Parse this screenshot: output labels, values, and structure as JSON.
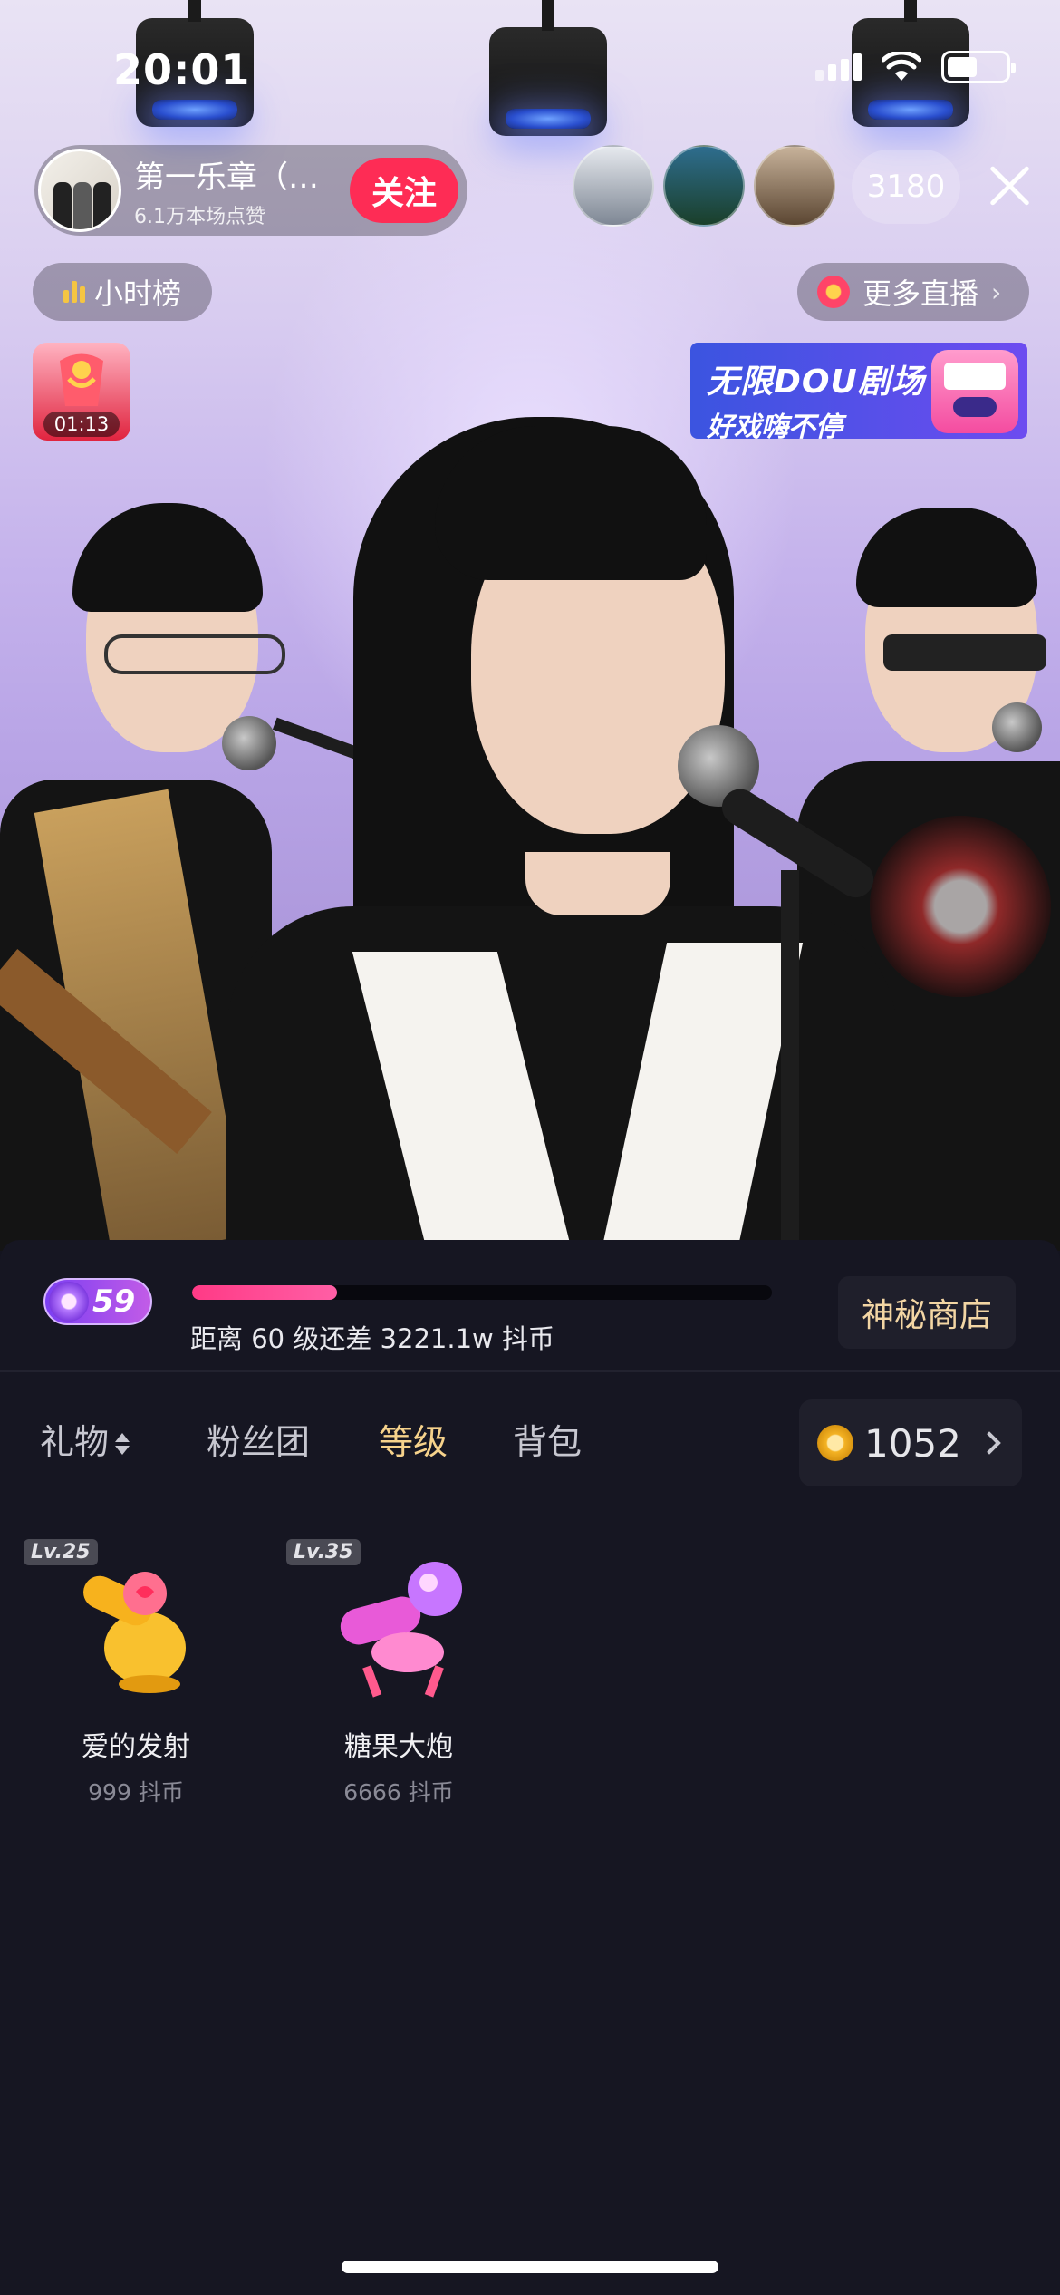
{
  "status_bar": {
    "time": "20:01"
  },
  "host": {
    "name": "第一乐章（…",
    "likes": "6.1万本场点赞",
    "follow_label": "关注"
  },
  "audience": {
    "count": "3180"
  },
  "rank_label": "小时榜",
  "more_live_label": "更多直播",
  "gift_timer": "01:13",
  "banner": {
    "line1": "无限DOU剧场",
    "line2": "好戏嗨不停"
  },
  "level": {
    "current": "59",
    "progress": 0.25,
    "text": "距离 60 级还差 3221.1w 抖币",
    "shop_label": "神秘商店"
  },
  "tabs": [
    {
      "label": "礼物",
      "active": false
    },
    {
      "label": "粉丝团",
      "active": false
    },
    {
      "label": "等级",
      "active": true
    },
    {
      "label": "背包",
      "active": false
    }
  ],
  "balance": "1052",
  "gifts": [
    {
      "level": "Lv.25",
      "name": "爱的发射",
      "price": "999 抖币",
      "icon": "love-launcher-icon"
    },
    {
      "level": "Lv.35",
      "name": "糖果大炮",
      "price": "6666 抖币",
      "icon": "candy-cannon-icon"
    }
  ],
  "colors": {
    "follow": "#fe2c55",
    "active_tab": "#f6d28b",
    "progress": "#ff3a86",
    "panel_bg": "#161622"
  }
}
